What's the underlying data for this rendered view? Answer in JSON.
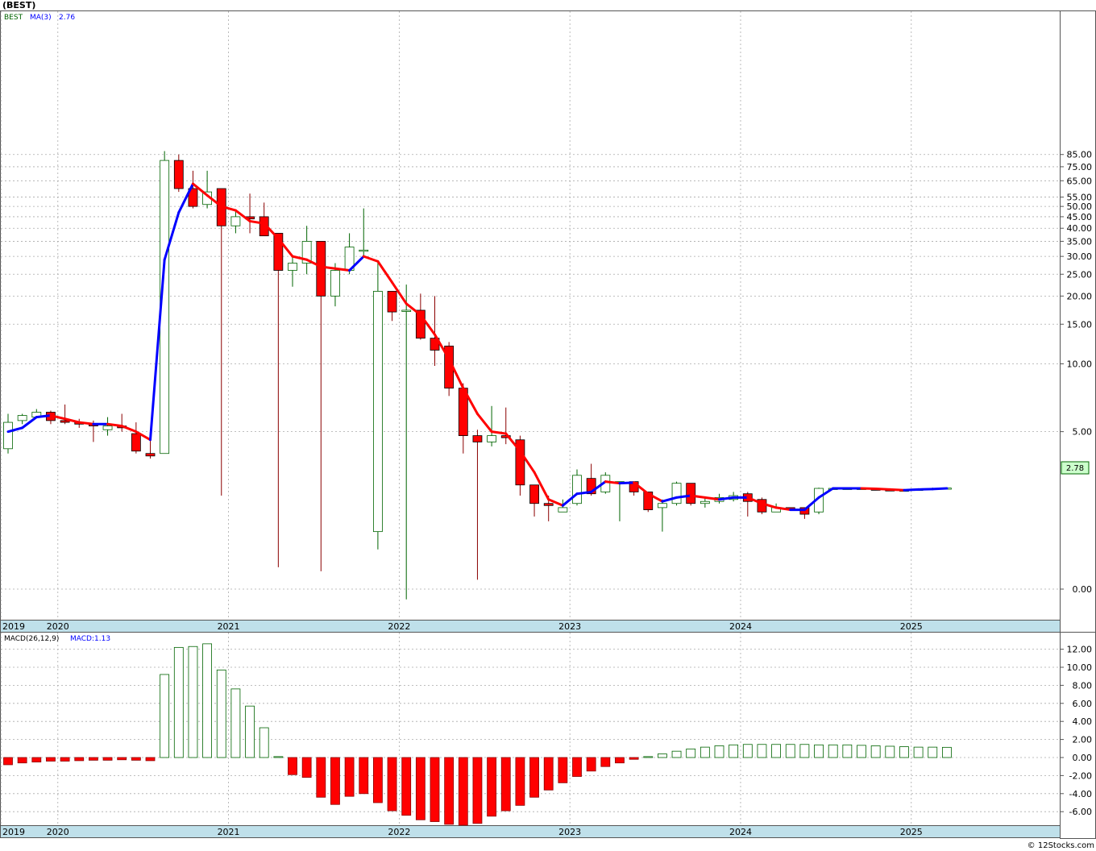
{
  "header": {
    "title": "(BEST)",
    "symbol": "BEST",
    "ma_label": "MA(3)",
    "ma_value": "2.76"
  },
  "macd_header": {
    "label": "MACD(26,12,9)",
    "value_label": "MACD:1.13"
  },
  "footer": {
    "brand": "© 12Stocks.com"
  },
  "price_tag": "2.78",
  "colors": {
    "up": "#006400",
    "down": "#ff0000",
    "ma_rising": "#0000ff",
    "ma_falling": "#ff0000",
    "axis_band": "#bfe0ea",
    "grid": "#aaaaaa"
  },
  "chart_data": [
    {
      "type": "candlestick",
      "interval": "monthly",
      "x_labels": [
        {
          "i": -0.5,
          "label": "2019"
        },
        {
          "i": 3.5,
          "label": "2020"
        },
        {
          "i": 15.5,
          "label": "2021"
        },
        {
          "i": 27.5,
          "label": "2022"
        },
        {
          "i": 39.5,
          "label": "2023"
        },
        {
          "i": 51.5,
          "label": "2024"
        },
        {
          "i": 63.5,
          "label": "2025"
        }
      ],
      "y_scale": "log",
      "y_ticks": [
        "85.00",
        "75.00",
        "65.00",
        "55.00",
        "50.00",
        "45.00",
        "40.00",
        "35.00",
        "30.00",
        "25.00",
        "20.00",
        "15.00",
        "10.00",
        "5.00",
        "0.00"
      ],
      "y_tick_values": [
        85,
        75,
        65,
        55,
        50,
        45,
        40,
        35,
        30,
        25,
        20,
        15,
        10,
        5,
        1
      ],
      "ohlc": [
        [
          4.2,
          6.0,
          4.0,
          5.5
        ],
        [
          5.6,
          6.0,
          5.4,
          5.9
        ],
        [
          5.8,
          6.3,
          5.8,
          6.1
        ],
        [
          6.1,
          6.2,
          5.4,
          5.6
        ],
        [
          5.6,
          6.6,
          5.4,
          5.5
        ],
        [
          5.5,
          5.7,
          5.2,
          5.4
        ],
        [
          5.4,
          5.6,
          4.5,
          5.3
        ],
        [
          5.1,
          5.8,
          4.8,
          5.3
        ],
        [
          5.3,
          6.0,
          5.0,
          5.2
        ],
        [
          4.9,
          5.5,
          4.0,
          4.1
        ],
        [
          4.0,
          4.7,
          3.8,
          3.9
        ],
        [
          4.0,
          88,
          4.0,
          80
        ],
        [
          80,
          85,
          58,
          60
        ],
        [
          60,
          72,
          49,
          50
        ],
        [
          51,
          72,
          49,
          58
        ],
        [
          60,
          60,
          2.6,
          41
        ],
        [
          41,
          48,
          38,
          45
        ],
        [
          45,
          57,
          38,
          44
        ],
        [
          45,
          52,
          37,
          37
        ],
        [
          38,
          38,
          1.25,
          26
        ],
        [
          26,
          30,
          22,
          28
        ],
        [
          28,
          41,
          25,
          35
        ],
        [
          35,
          35,
          1.2,
          20
        ],
        [
          20,
          28,
          18,
          26
        ],
        [
          26,
          38,
          25,
          33
        ],
        [
          32,
          49,
          30,
          32
        ],
        [
          1.8,
          28,
          1.5,
          21
        ],
        [
          21,
          21,
          15.5,
          17
        ],
        [
          17.3,
          22.5,
          0.9,
          17.3
        ],
        [
          17.3,
          20.5,
          12.8,
          13
        ],
        [
          13,
          20,
          9.8,
          11.5
        ],
        [
          12,
          12.5,
          7.2,
          7.8
        ],
        [
          7.8,
          8.2,
          4.0,
          4.8
        ],
        [
          4.8,
          5.1,
          1.1,
          4.5
        ],
        [
          4.5,
          6.5,
          4.3,
          4.8
        ],
        [
          4.8,
          6.4,
          4.4,
          4.7
        ],
        [
          4.6,
          4.8,
          2.6,
          2.9
        ],
        [
          2.9,
          2.9,
          2.1,
          2.4
        ],
        [
          2.4,
          2.6,
          2.0,
          2.35
        ],
        [
          2.2,
          2.5,
          2.2,
          2.3
        ],
        [
          2.4,
          3.4,
          2.35,
          3.2
        ],
        [
          3.1,
          3.6,
          2.6,
          2.65
        ],
        [
          2.7,
          3.3,
          2.65,
          3.2
        ],
        [
          3.0,
          3.0,
          2.0,
          3.0
        ],
        [
          3.0,
          3.0,
          2.6,
          2.7
        ],
        [
          2.7,
          2.7,
          2.2,
          2.25
        ],
        [
          2.3,
          2.5,
          1.8,
          2.4
        ],
        [
          2.4,
          3.0,
          2.35,
          2.95
        ],
        [
          2.95,
          2.95,
          2.35,
          2.4
        ],
        [
          2.4,
          2.55,
          2.3,
          2.45
        ],
        [
          2.45,
          2.65,
          2.4,
          2.55
        ],
        [
          2.5,
          2.7,
          2.45,
          2.6
        ],
        [
          2.65,
          2.7,
          2.1,
          2.45
        ],
        [
          2.5,
          2.55,
          2.15,
          2.2
        ],
        [
          2.2,
          2.4,
          2.2,
          2.3
        ],
        [
          2.3,
          2.3,
          2.25,
          2.25
        ],
        [
          2.3,
          2.3,
          2.05,
          2.15
        ],
        [
          2.2,
          2.82,
          2.15,
          2.8
        ],
        [
          2.8,
          2.82,
          2.78,
          2.8
        ],
        [
          2.8,
          2.8,
          2.8,
          2.8
        ],
        [
          2.8,
          2.81,
          2.8,
          2.8
        ],
        [
          2.78,
          2.8,
          2.75,
          2.76
        ],
        [
          2.76,
          2.77,
          2.74,
          2.75
        ],
        [
          2.74,
          2.76,
          2.73,
          2.75
        ],
        [
          2.74,
          2.79,
          2.74,
          2.78
        ],
        [
          2.78,
          2.82,
          2.77,
          2.8
        ],
        [
          2.8,
          2.82,
          2.78,
          2.81
        ]
      ],
      "ma3": [
        5.0,
        5.2,
        5.8,
        5.9,
        5.7,
        5.5,
        5.4,
        5.4,
        5.3,
        5.0,
        4.6,
        29,
        47,
        63,
        56,
        50,
        48,
        43,
        42,
        36,
        30,
        29,
        27,
        26.5,
        26,
        30,
        28.5,
        23,
        18.5,
        16.5,
        13.5,
        10.5,
        7.8,
        6.0,
        5.0,
        4.9,
        4.1,
        3.3,
        2.5,
        2.35,
        2.65,
        2.7,
        3.0,
        2.95,
        2.97,
        2.65,
        2.45,
        2.55,
        2.6,
        2.55,
        2.5,
        2.55,
        2.55,
        2.4,
        2.3,
        2.25,
        2.25,
        2.55,
        2.8,
        2.8,
        2.8,
        2.79,
        2.77,
        2.75,
        2.77,
        2.78,
        2.8
      ]
    },
    {
      "type": "bar",
      "title": "MACD(26,12,9)",
      "y_ticks": [
        "12.00",
        "10.00",
        "8.00",
        "6.00",
        "4.00",
        "2.00",
        "0.00",
        "-2.00",
        "-4.00",
        "-6.00"
      ],
      "y_tick_values": [
        12,
        10,
        8,
        6,
        4,
        2,
        0,
        -2,
        -4,
        -6
      ],
      "values": [
        -0.8,
        -0.6,
        -0.5,
        -0.4,
        -0.4,
        -0.35,
        -0.3,
        -0.3,
        -0.25,
        -0.3,
        -0.35,
        9.2,
        12.2,
        12.3,
        12.6,
        9.7,
        7.6,
        5.7,
        3.3,
        0.1,
        -1.9,
        -2.2,
        -4.4,
        -5.2,
        -4.3,
        -4.0,
        -5.0,
        -5.9,
        -6.4,
        -6.9,
        -7.1,
        -7.4,
        -7.5,
        -7.3,
        -6.5,
        -5.9,
        -5.3,
        -4.4,
        -3.6,
        -2.8,
        -2.1,
        -1.5,
        -1.0,
        -0.6,
        -0.2,
        0.1,
        0.4,
        0.7,
        0.95,
        1.15,
        1.3,
        1.4,
        1.45,
        1.45,
        1.45,
        1.45,
        1.45,
        1.4,
        1.4,
        1.4,
        1.35,
        1.3,
        1.25,
        1.2,
        1.15,
        1.15,
        1.13
      ]
    }
  ]
}
